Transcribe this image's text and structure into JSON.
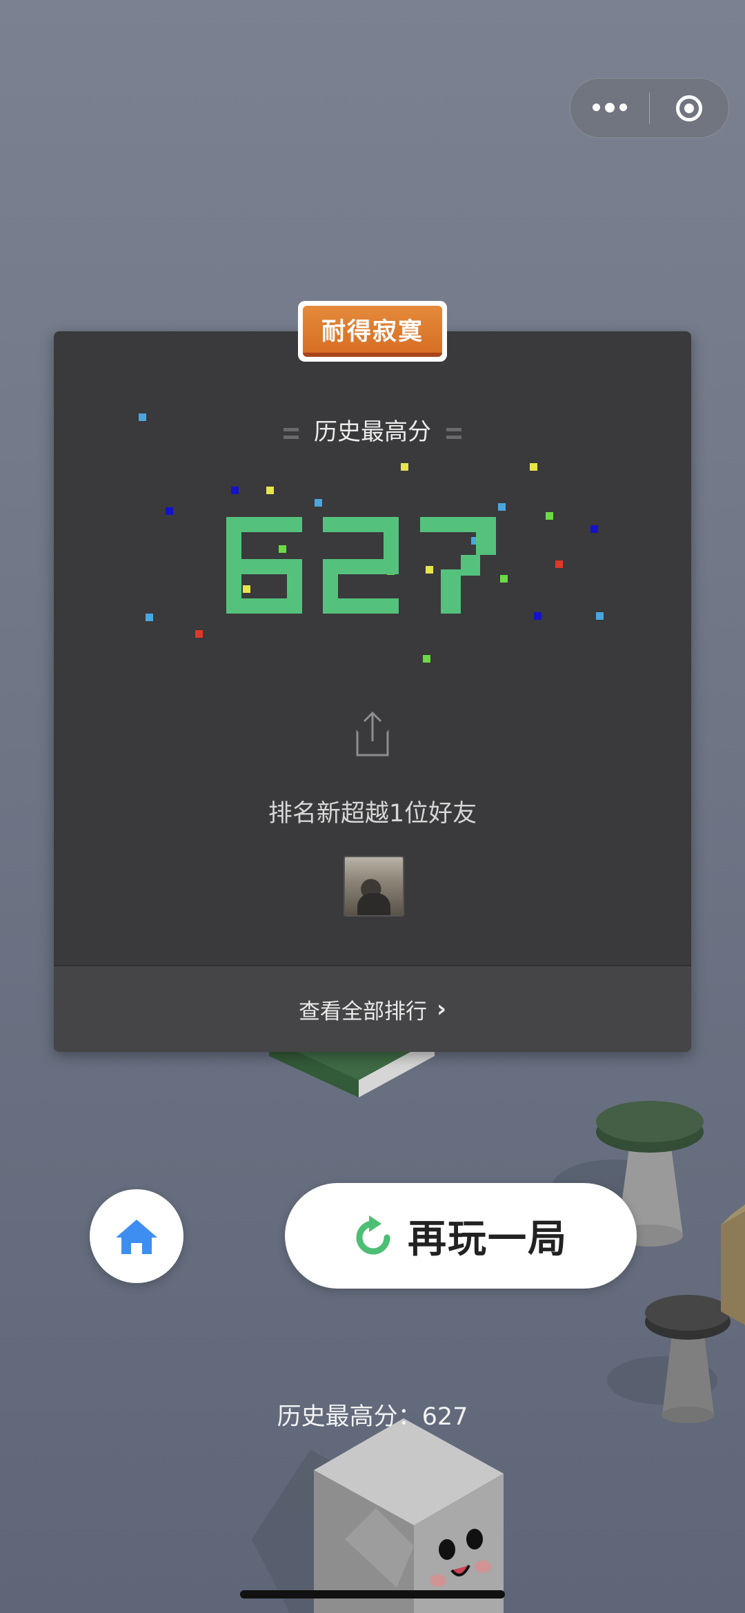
{
  "badge": {
    "label": "耐得寂寞"
  },
  "card": {
    "title": "历史最高分",
    "score": "627",
    "rank_text": "排名新超越1位好友",
    "view_all_label": "查看全部排行",
    "chevron_glyph": "›"
  },
  "buttons": {
    "replay_label": "再玩一局"
  },
  "bottom": {
    "high_score_text": "历史最高分：627"
  },
  "colors": {
    "score_green": "#54c27c",
    "badge_orange": "#d97325",
    "home_blue": "#3d8ef0",
    "replay_green": "#4cbf74"
  }
}
